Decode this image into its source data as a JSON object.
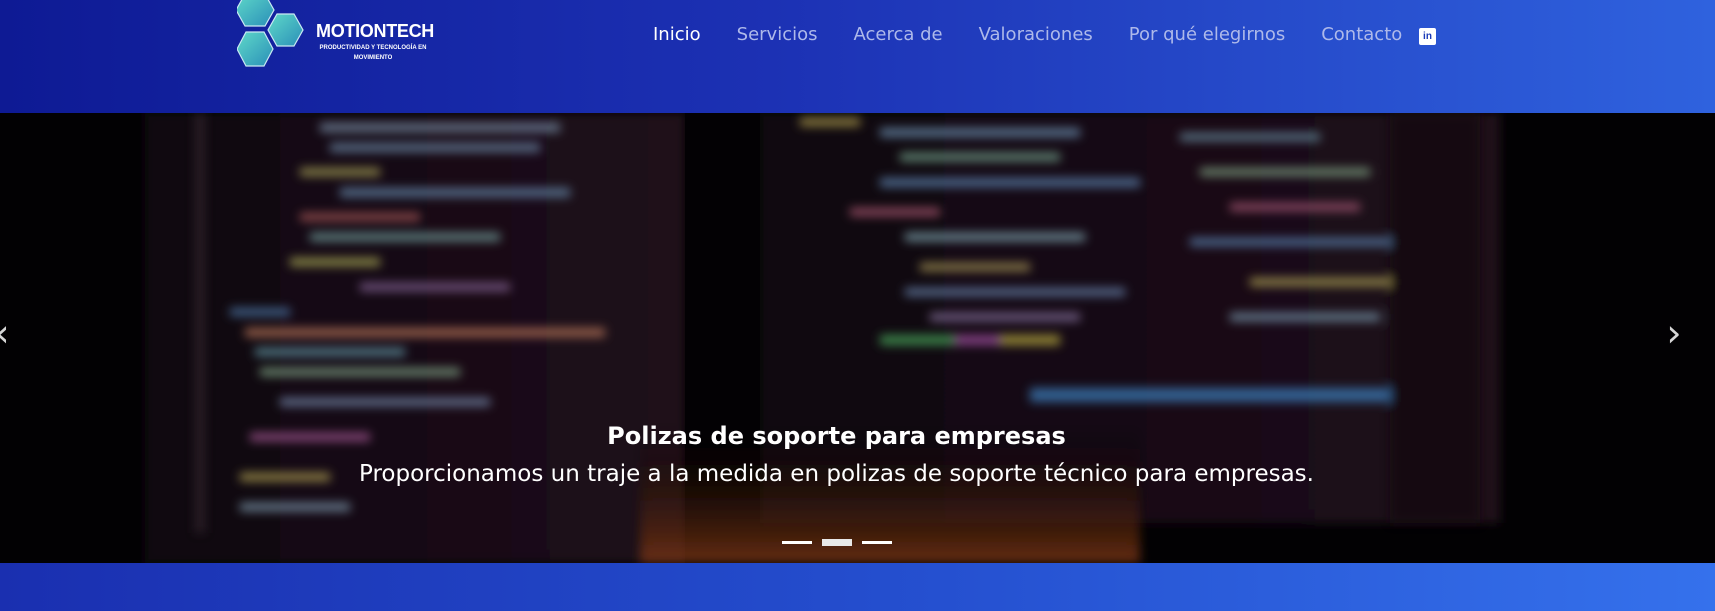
{
  "brand": {
    "name": "MOTIONTECH",
    "tagline": "PRODUCTIVIDAD Y TECNOLOGÍA EN MOVIMIENTO",
    "logo_icon": "hexagon-cluster-icon"
  },
  "nav": {
    "items": [
      {
        "label": "Inicio",
        "active": true
      },
      {
        "label": "Servicios",
        "active": false
      },
      {
        "label": "Acerca de",
        "active": false
      },
      {
        "label": "Valoraciones",
        "active": false
      },
      {
        "label": "Por qué elegirnos",
        "active": false
      },
      {
        "label": "Contacto",
        "active": false
      }
    ],
    "linkedin_icon": "linkedin-icon",
    "linkedin_glyph": "in"
  },
  "hero": {
    "title": "Polizas de soporte para empresas",
    "text": "Proporcionamos un traje a la medida en polizas de soporte técnico para empresas.",
    "prev_glyph": "‹",
    "next_glyph": "›",
    "slide_count": 3,
    "active_slide": 2
  },
  "colors": {
    "nav_start": "#0e1a94",
    "nav_end": "#2f62de",
    "hex_fill": "#3cb8c0",
    "active_link": "#ffffff",
    "link": "#aeb9ea"
  }
}
